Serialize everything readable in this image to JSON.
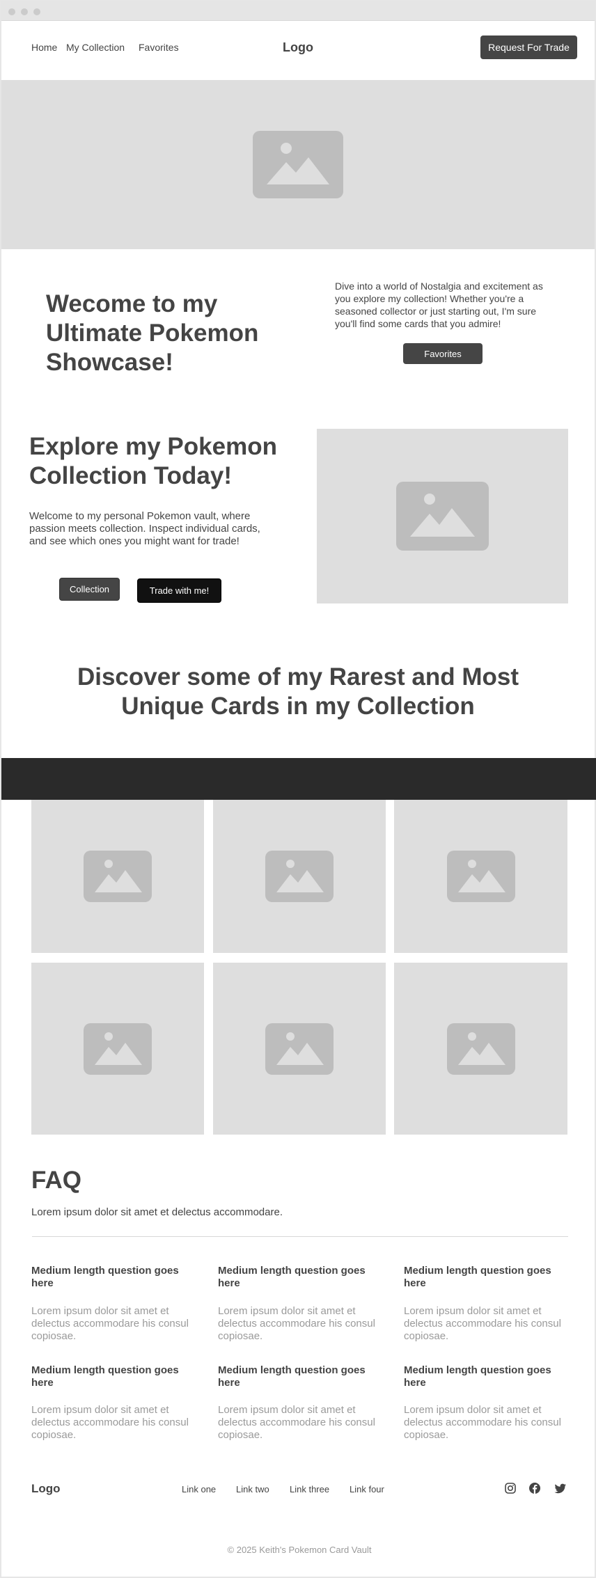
{
  "nav": {
    "links": [
      "Home",
      "My Collection",
      "Favorites"
    ],
    "logo": "Logo",
    "cta": "Request For Trade"
  },
  "intro": {
    "heading": "Wecome to my Ultimate Pokemon Showcase!",
    "text": "Dive into a world of Nostalgia and excitement as you explore my collection! Whether you're a seasoned collector or just starting out, I'm sure you'll find some cards that you admire!",
    "button": "Favorites"
  },
  "explore": {
    "heading": "Explore my Pokemon Collection Today!",
    "text": "Welcome to my personal Pokemon vault, where passion meets collection. Inspect individual cards, and see which ones you might want for trade!",
    "primary_button": "Collection",
    "secondary_button": "Trade with me!"
  },
  "discover": {
    "heading": "Discover some of my Rarest and Most Unique Cards in my Collection"
  },
  "faq": {
    "title": "FAQ",
    "subtitle": "Lorem ipsum dolor sit amet et delectus accommodare.",
    "items": [
      {
        "q": "Medium length question goes here",
        "a": "Lorem ipsum dolor sit amet et delectus accommodare his consul copiosae."
      },
      {
        "q": "Medium length question goes here",
        "a": "Lorem ipsum dolor sit amet et delectus accommodare his consul copiosae."
      },
      {
        "q": "Medium length question goes here",
        "a": "Lorem ipsum dolor sit amet et delectus accommodare his consul copiosae."
      },
      {
        "q": "Medium length question goes here",
        "a": "Lorem ipsum dolor sit amet et delectus accommodare his consul copiosae."
      },
      {
        "q": "Medium length question goes here",
        "a": "Lorem ipsum dolor sit amet et delectus accommodare his consul copiosae."
      },
      {
        "q": "Medium length question goes here",
        "a": "Lorem ipsum dolor sit amet et delectus accommodare his consul copiosae."
      }
    ]
  },
  "footer": {
    "logo": "Logo",
    "links": [
      "Link one",
      "Link two",
      "Link three",
      "Link four"
    ],
    "social_icons": [
      "instagram-icon",
      "facebook-icon",
      "twitter-icon"
    ],
    "copyright": "© 2025 Keith's Pokemon Card Vault"
  },
  "colors": {
    "dark_button": "#454545",
    "black_button": "#111111",
    "band": "#2a2a2a",
    "placeholder": "#dedede",
    "placeholder_icon": "#bdbdbd",
    "muted_text": "#9a9a9a"
  }
}
